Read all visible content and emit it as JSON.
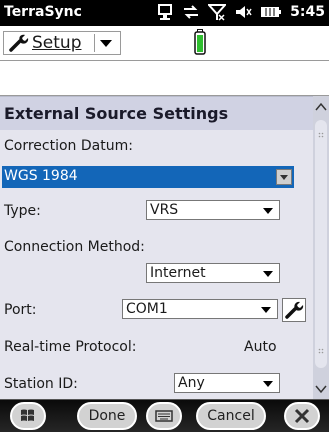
{
  "status_bar": {
    "app_name": "TerraSync",
    "time": "5:45",
    "icons": [
      "connection-icon",
      "sync-icon",
      "no-signal-icon",
      "volume-icon",
      "battery-icon"
    ]
  },
  "toolbar": {
    "menu_label": "Setup"
  },
  "form": {
    "title": "External Source Settings",
    "correction_datum_label": "Correction Datum:",
    "correction_datum_value": "WGS 1984",
    "type_label": "Type:",
    "type_value": "VRS",
    "connection_method_label": "Connection Method:",
    "connection_method_value": "Internet",
    "port_label": "Port:",
    "port_value": "COM1",
    "rt_protocol_label": "Real-time Protocol:",
    "rt_protocol_value": "Auto",
    "station_id_label": "Station ID:",
    "station_id_value": "Any"
  },
  "softkeys": {
    "done_label": "Done",
    "cancel_label": "Cancel"
  },
  "colors": {
    "selection": "#1366b8",
    "form_bg": "#e5e5ee",
    "header_bg": "#d0d2e3",
    "status_bar": "#000000"
  }
}
